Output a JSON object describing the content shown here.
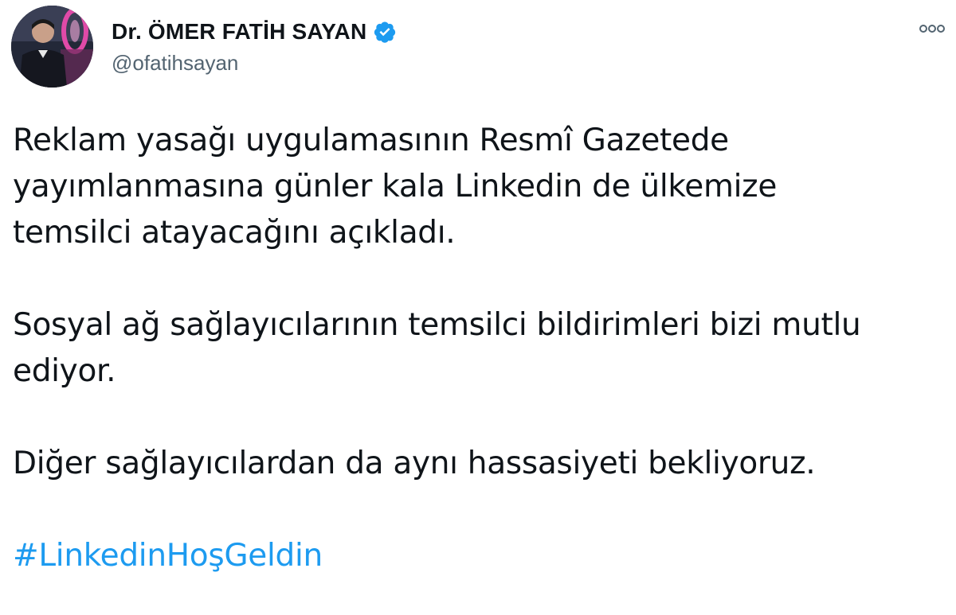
{
  "tweet": {
    "author": {
      "display_name": "Dr. ÖMER FATİH SAYAN",
      "handle": "@ofatihsayan",
      "verified": true,
      "avatar_icon": "profile-photo"
    },
    "more_icon": "more-options-icon",
    "paragraphs": [
      "Reklam yasağı uygulamasının Resmî Gazetede",
      "yayımlanmasına günler kala Linkedin de ülkemize",
      "temsilci atayacağını açıkladı.",
      "Sosyal ağ sağlayıcılarının temsilci bildirimleri bizi mutlu",
      "ediyor.",
      "Diğer sağlayıcılardan da aynı hassasiyeti bekliyoruz."
    ],
    "hashtag": "#LinkedinHoşGeldin",
    "colors": {
      "text": "#0f1419",
      "secondary": "#536471",
      "link": "#1d9bf0",
      "verified": "#1d9bf0"
    }
  }
}
